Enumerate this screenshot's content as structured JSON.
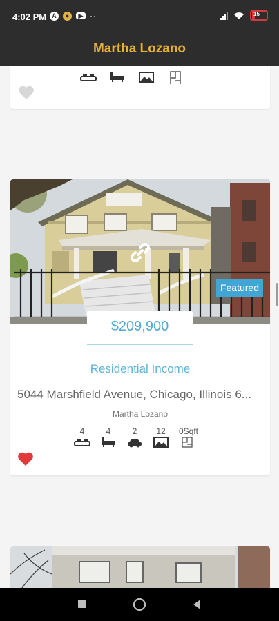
{
  "status_bar": {
    "time": "4:02 PM",
    "icons": [
      "a-badge-icon",
      "coin-icon",
      "youtube-icon"
    ],
    "battery": "15"
  },
  "app_bar": {
    "title": "Martha Lozano"
  },
  "colors": {
    "bar": "#2d2d2d",
    "title": "#e6b033",
    "accent": "#51a9d3",
    "badge": "#3fa6d6",
    "favorite": "#e23a3a"
  },
  "listings": [
    {
      "favorite": false,
      "feature_icons": [
        "bed-icon",
        "bath-icon",
        "photo-icon",
        "area-icon"
      ]
    },
    {
      "badge": "Featured",
      "price": "$209,900",
      "category": "Residential Income",
      "address": "5044 Marshfield Avenue, Chicago, Illinois 6...",
      "agent": "Martha Lozano",
      "features": [
        {
          "icon": "bed-icon",
          "value": "4"
        },
        {
          "icon": "bath-icon",
          "value": "4"
        },
        {
          "icon": "garage-icon",
          "value": "2"
        },
        {
          "icon": "photo-icon",
          "value": "12"
        },
        {
          "icon": "area-icon",
          "value": "0Sqft"
        }
      ],
      "favorite": true
    },
    {
      "photo_only": true
    }
  ]
}
